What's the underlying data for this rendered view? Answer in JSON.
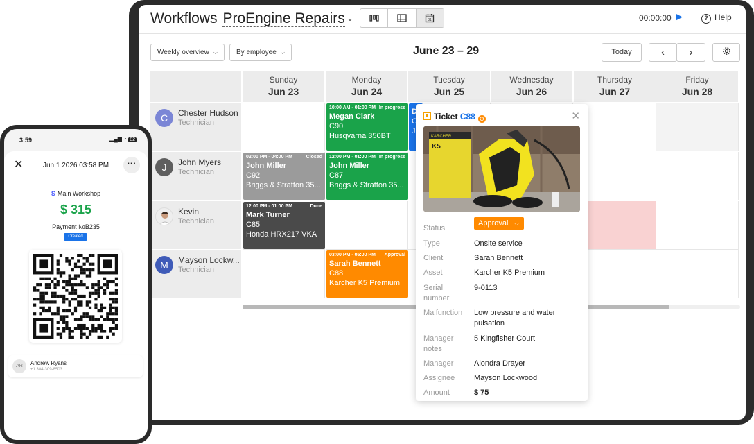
{
  "header": {
    "title": "Workflows",
    "project": "ProEngine Repairs",
    "view_icons": [
      "board-view-icon",
      "table-view-icon",
      "calendar-view-icon"
    ],
    "calendar_day_num": "31",
    "timer": "00:00:00",
    "help_label": "Help"
  },
  "toolbar": {
    "view_mode": "Weekly overview",
    "group_by": "By employee",
    "range": "June 23 – 29",
    "today_label": "Today"
  },
  "days": [
    {
      "name": "Sunday",
      "date": "Jun 23"
    },
    {
      "name": "Monday",
      "date": "Jun 24"
    },
    {
      "name": "Tuesday",
      "date": "Jun 25"
    },
    {
      "name": "Wednesday",
      "date": "Jun 26"
    },
    {
      "name": "Thursday",
      "date": "Jun 27"
    },
    {
      "name": "Friday",
      "date": "Jun 28"
    }
  ],
  "employees": [
    {
      "name": "Chester Hudson",
      "role": "Technician",
      "initial": "C",
      "color": "#7b86d6"
    },
    {
      "name": "John Myers",
      "role": "Technician",
      "initial": "J",
      "color": "#5f5f5f"
    },
    {
      "name": "Kevin",
      "role": "Technician",
      "initial": "",
      "color": "#d9d2cc"
    },
    {
      "name": "Mayson Lockw...",
      "role": "Technician",
      "initial": "M",
      "color": "#3f5bb8"
    }
  ],
  "events": [
    {
      "time": "10:00 AM - 01:00 PM",
      "status": "In progress",
      "name": "Megan Clark",
      "code": "C90",
      "asset": "Husqvarna 350BT",
      "color": "#1aa34a"
    },
    {
      "time": "",
      "status": "",
      "name": "D",
      "code": "C",
      "asset": "Jo",
      "color": "#1a73e8"
    },
    {
      "time": "02:00 PM - 04:00 PM",
      "status": "Closed",
      "name": "John Miller",
      "code": "C92",
      "asset": "Briggs & Stratton 35...",
      "color": "#9b9b9b"
    },
    {
      "time": "12:00 PM - 01:00 PM",
      "status": "In progress",
      "name": "John Miller",
      "code": "C87",
      "asset": "Briggs & Stratton 35...",
      "color": "#1aa34a"
    },
    {
      "time": "12:00 PM - 01:00 PM",
      "status": "Done",
      "name": "Mark Turner",
      "code": "C85",
      "asset": "Honda HRX217 VKA",
      "color": "#4a4a4a"
    },
    {
      "time": "03:00 PM - 05:00 PM",
      "status": "Approval",
      "name": "Sarah Bennett",
      "code": "C88",
      "asset": "Karcher K5 Premium",
      "color": "#ff8a00"
    }
  ],
  "popup": {
    "title_prefix": "Ticket",
    "ticket_no": "C88",
    "image_brand": "KARCHER",
    "image_model": "K5",
    "status_label": "Status",
    "status_value": "Approval",
    "fields": [
      {
        "label": "Type",
        "value": "Onsite service"
      },
      {
        "label": "Client",
        "value": "Sarah Bennett"
      },
      {
        "label": "Asset",
        "value": "Karcher K5 Premium"
      },
      {
        "label": "Serial number",
        "value": "9-0113"
      },
      {
        "label": "Malfunction",
        "value": "Low pressure and water pulsation"
      },
      {
        "label": "Manager notes",
        "value": "5 Kingfisher Court"
      },
      {
        "label": "Manager",
        "value": "Alondra Drayer"
      },
      {
        "label": "Assignee",
        "value": "Mayson Lockwood"
      },
      {
        "label": "Amount",
        "value": "$ 75"
      }
    ]
  },
  "phone": {
    "time": "3:59",
    "battery": "82",
    "date": "Jun 1 2026 03:58 PM",
    "shop": "Main Workshop",
    "amount": "$ 315",
    "payment": "Payment №B235",
    "badge": "Created",
    "contact_initials": "AR",
    "contact_name": "Andrew Ryans",
    "contact_phone": "+1 384-309-8503"
  },
  "colors": {
    "accent": "#1a73e8",
    "approval": "#ff8a00",
    "in_progress": "#1aa34a",
    "highlight": "#f9d2d2"
  }
}
